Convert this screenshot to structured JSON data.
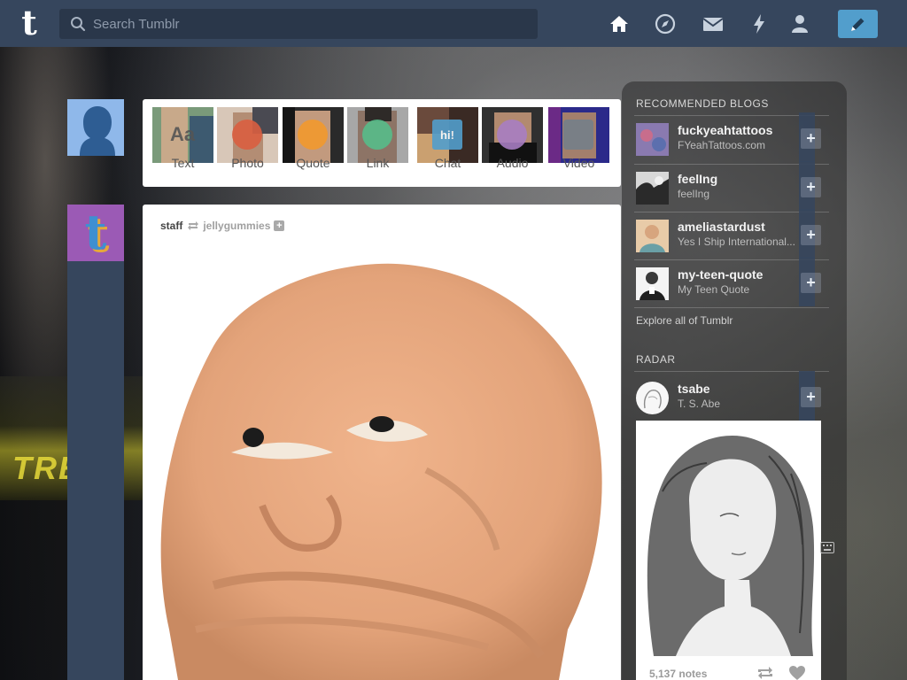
{
  "header": {
    "search_placeholder": "Search Tumblr",
    "logo_letter": "t"
  },
  "post_types": [
    {
      "label": "Text",
      "glyph": "Aa",
      "color": "#444444"
    },
    {
      "label": "Photo",
      "glyph": "",
      "color": "#d95e40"
    },
    {
      "label": "Quote",
      "glyph": "",
      "color": "#f2992e"
    },
    {
      "label": "Link",
      "glyph": "",
      "color": "#56bc8a"
    },
    {
      "label": "Chat",
      "glyph": "hi!",
      "color": "#529ecc"
    },
    {
      "label": "Audio",
      "glyph": "",
      "color": "#a77dc2"
    },
    {
      "label": "Video",
      "glyph": "",
      "color": "#748089"
    }
  ],
  "post": {
    "author": "staff",
    "reblogged_from": "jellygummies",
    "follow_symbol": "+"
  },
  "sidebar": {
    "recommended_heading": "RECOMMENDED BLOGS",
    "blogs": [
      {
        "name": "fuckyeahtattoos",
        "title": "FYeahTattoos.com"
      },
      {
        "name": "feelIng",
        "title": "feelIng"
      },
      {
        "name": "ameliastardust",
        "title": "Yes I Ship International..."
      },
      {
        "name": "my-teen-quote",
        "title": "My Teen Quote"
      }
    ],
    "follow_symbol": "+",
    "explore_label": "Explore all of Tumblr",
    "radar_heading": "RADAR",
    "radar": {
      "name": "tsabe",
      "title": "T. S. Abe",
      "notes": "5,137 notes"
    }
  },
  "colors": {
    "header": "#36465d",
    "compose": "#529ecc"
  }
}
